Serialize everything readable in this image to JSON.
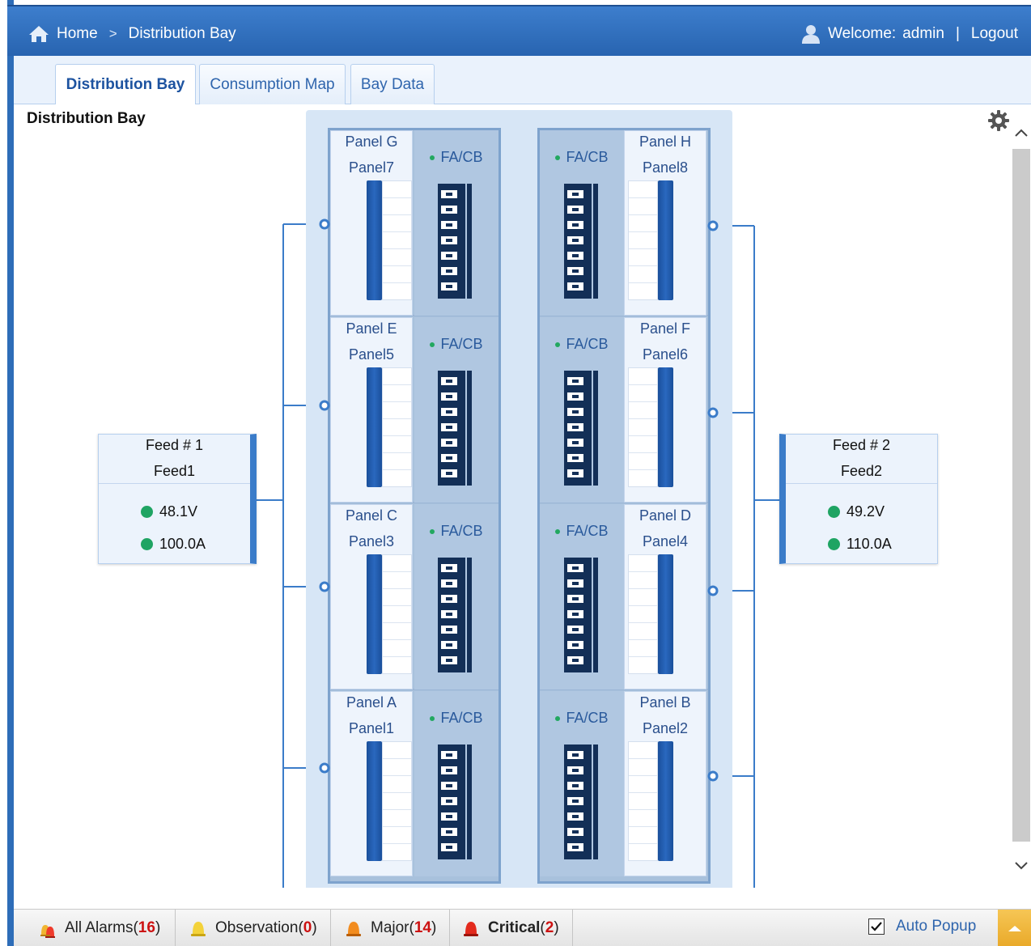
{
  "header": {
    "breadcrumb": {
      "home": "Home",
      "separator": ">",
      "current": "Distribution Bay"
    },
    "welcome": "Welcome:",
    "user": "admin",
    "divider": "|",
    "logout": "Logout",
    "icons": {
      "home": "home-icon",
      "user": "user-icon"
    }
  },
  "tabs": [
    {
      "label": "Distribution Bay",
      "active": true
    },
    {
      "label": "Consumption Map",
      "active": false
    },
    {
      "label": "Bay Data",
      "active": false
    }
  ],
  "page": {
    "title": "Distribution Bay",
    "settings_icon": "gear-icon"
  },
  "feeds": [
    {
      "name": "Feed # 1",
      "id": "Feed1",
      "voltage": "48.1V",
      "current": "100.0A",
      "status_color": "#1fa463"
    },
    {
      "name": "Feed # 2",
      "id": "Feed2",
      "voltage": "49.2V",
      "current": "110.0A",
      "status_color": "#1fa463"
    }
  ],
  "panels": {
    "left": [
      {
        "name": "Panel G",
        "id": "Panel7",
        "breaker": "FA/CB"
      },
      {
        "name": "Panel E",
        "id": "Panel5",
        "breaker": "FA/CB"
      },
      {
        "name": "Panel C",
        "id": "Panel3",
        "breaker": "FA/CB"
      },
      {
        "name": "Panel A",
        "id": "Panel1",
        "breaker": "FA/CB"
      }
    ],
    "right": [
      {
        "name": "Panel H",
        "id": "Panel8",
        "breaker": "FA/CB"
      },
      {
        "name": "Panel F",
        "id": "Panel6",
        "breaker": "FA/CB"
      },
      {
        "name": "Panel D",
        "id": "Panel4",
        "breaker": "FA/CB"
      },
      {
        "name": "Panel B",
        "id": "Panel2",
        "breaker": "FA/CB"
      }
    ]
  },
  "alarms": {
    "all": {
      "label": "All Alarms",
      "count": "16"
    },
    "observation": {
      "label": "Observation",
      "count": "0"
    },
    "major": {
      "label": "Major",
      "count": "14"
    },
    "critical": {
      "label": "Critical",
      "count": "2"
    },
    "auto_popup": {
      "label": "Auto Popup",
      "checked": true
    }
  },
  "colors": {
    "header": "#2e6db8",
    "accent": "#3b7cc9",
    "status_ok": "#1fa463",
    "alarm_count": "#cc1111"
  }
}
